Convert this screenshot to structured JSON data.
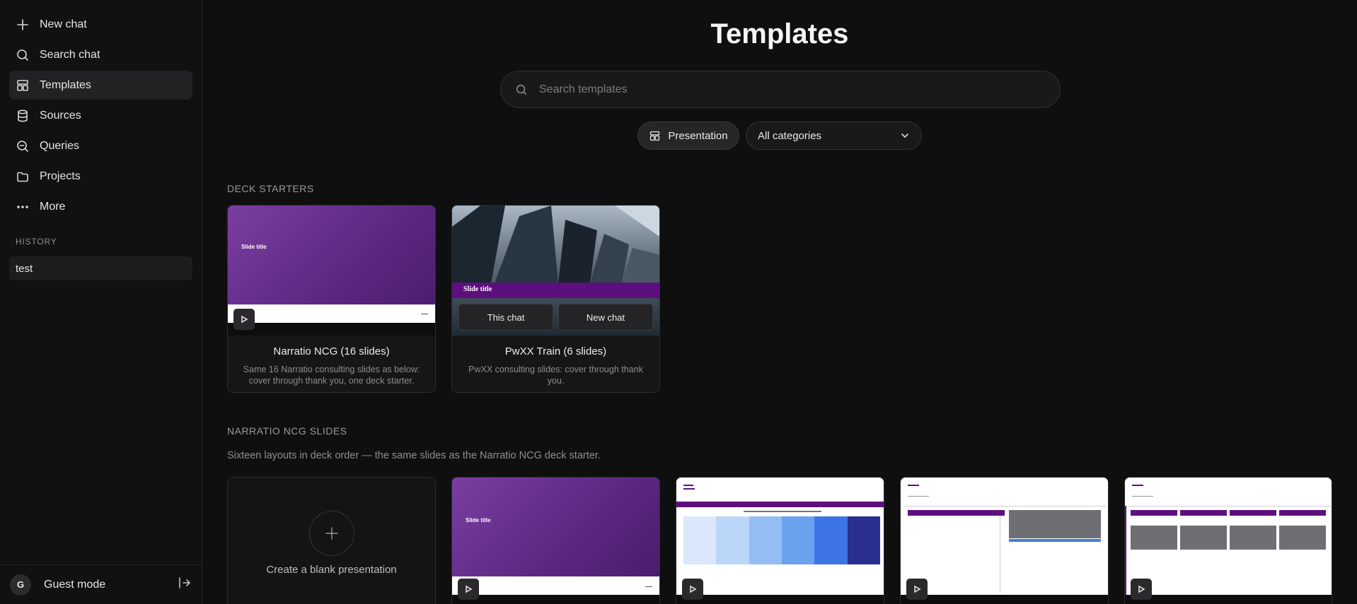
{
  "sidebar": {
    "nav": [
      {
        "label": "New chat",
        "icon": "plus-icon"
      },
      {
        "label": "Search chat",
        "icon": "search-icon"
      },
      {
        "label": "Templates",
        "icon": "templates-icon"
      },
      {
        "label": "Sources",
        "icon": "database-icon"
      },
      {
        "label": "Queries",
        "icon": "query-icon"
      },
      {
        "label": "Projects",
        "icon": "folder-icon"
      },
      {
        "label": "More",
        "icon": "more-icon"
      }
    ],
    "history_label": "HISTORY",
    "history_items": [
      {
        "label": "test"
      }
    ],
    "footer": {
      "avatar_initial": "G",
      "user_label": "Guest mode"
    }
  },
  "main": {
    "title": "Templates",
    "search": {
      "placeholder": "Search templates",
      "value": ""
    },
    "filters": {
      "type_label": "Presentation",
      "category_selected": "All categories"
    },
    "deck_starters": {
      "label": "DECK STARTERS",
      "cards": [
        {
          "title": "Narratio NCG (16 slides)",
          "description": "Same 16 Narratio consulting slides as below: cover through thank you, one deck starter.",
          "thumb_title": "Slide title"
        },
        {
          "title": "PwXX Train (6 slides)",
          "description": "PwXX consulting slides: cover through thank you.",
          "thumb_title": "Slide title",
          "this_chat_label": "This chat",
          "new_chat_label": "New chat"
        }
      ]
    },
    "narratio_slides": {
      "label": "NARRATIO NCG SLIDES",
      "description": "Sixteen layouts in deck order — the same slides as the Narratio NCG deck starter.",
      "blank_label": "Create a blank presentation",
      "cover_title": "Slide title"
    }
  },
  "colors": {
    "accent_purple": "#5e0f7e",
    "background": "#0f0f10"
  }
}
